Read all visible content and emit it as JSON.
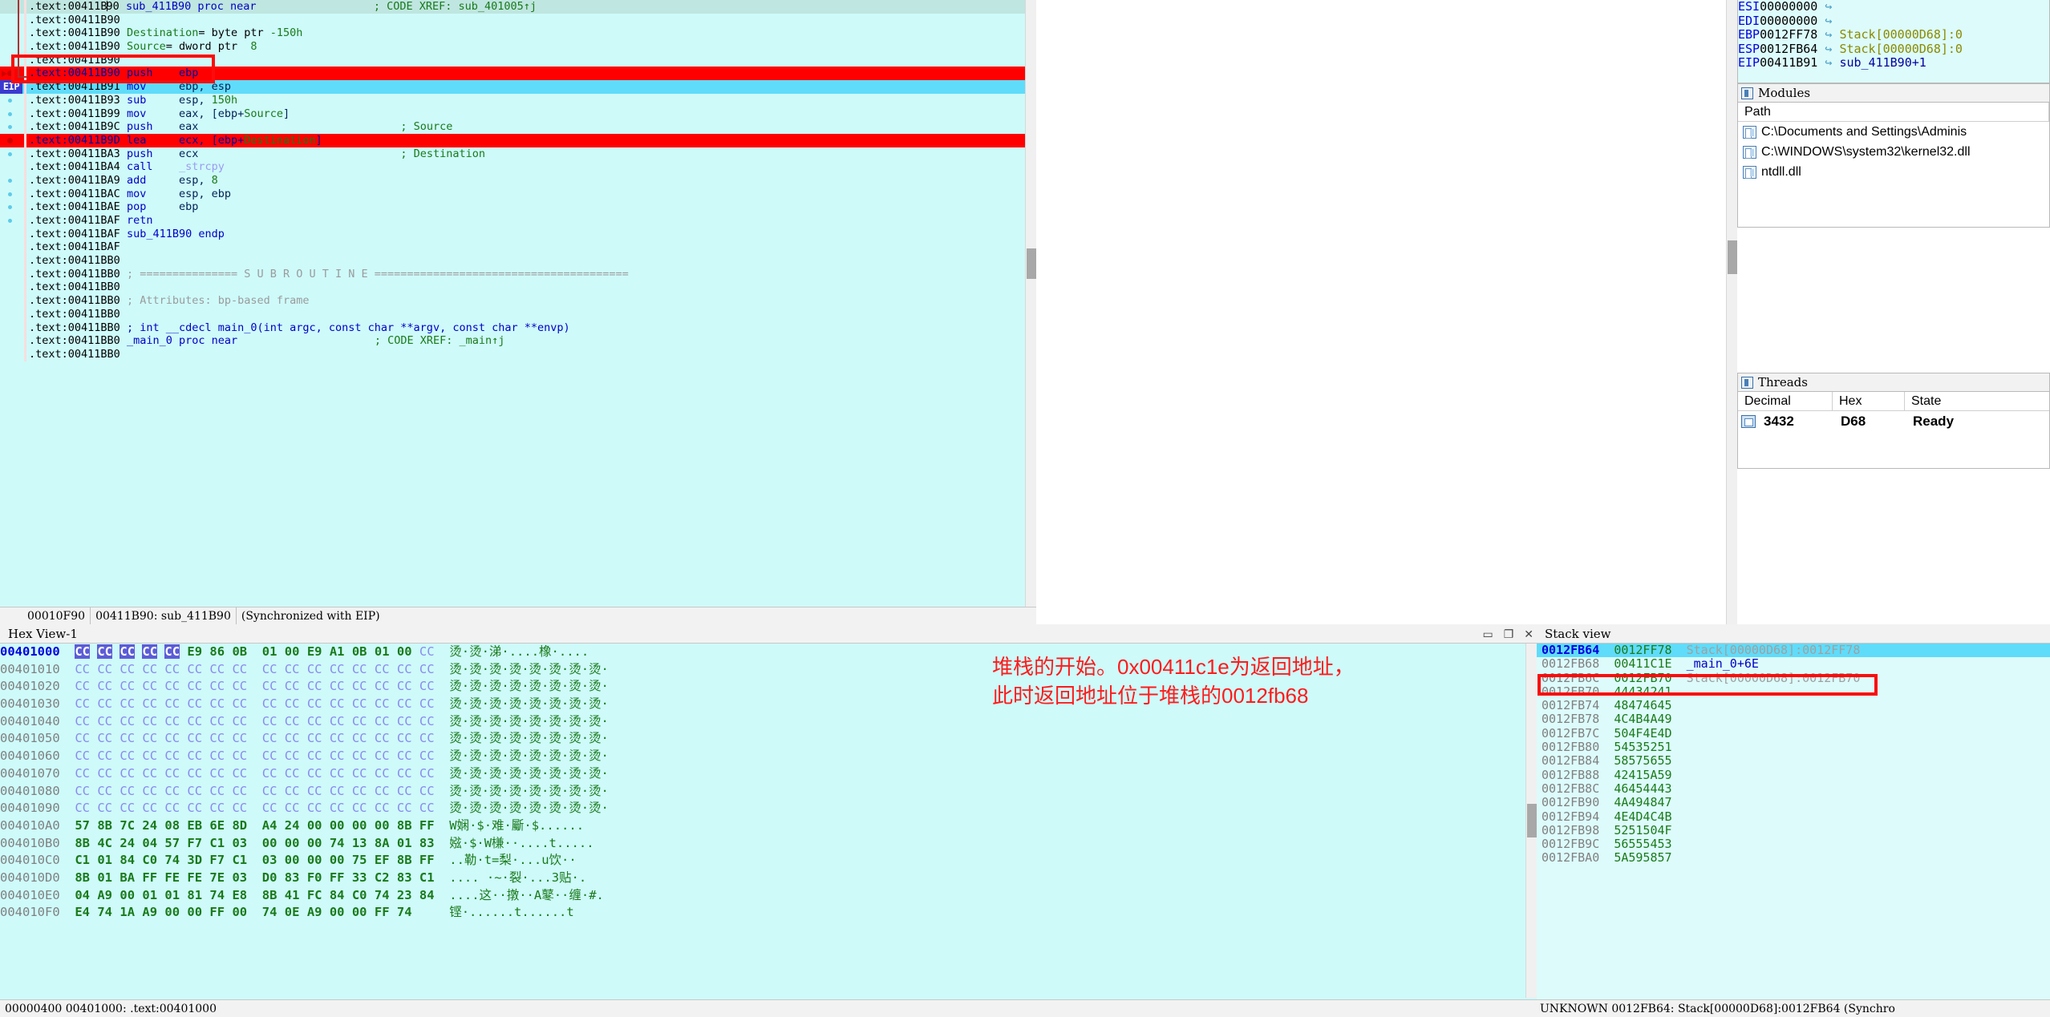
{
  "disassembly": {
    "panel_name": "IDA View",
    "lines": [
      {
        "addr": ".text:00411B90",
        "text": "sub_411B90 proc near",
        "comment": "; CODE XREF: sub_401005↑j",
        "style": "head",
        "kind": "proc"
      },
      {
        "addr": ".text:00411B90",
        "text": "",
        "comment": "",
        "style": "",
        "kind": "blank"
      },
      {
        "addr": ".text:00411B90",
        "text": "Destination= byte ptr -150h",
        "comment": "",
        "style": "",
        "kind": "vardef"
      },
      {
        "addr": ".text:00411B90",
        "text": "Source= dword ptr  8",
        "comment": "",
        "style": "",
        "kind": "vardef"
      },
      {
        "addr": ".text:00411B90",
        "text": "",
        "comment": "",
        "style": "",
        "kind": "blank"
      },
      {
        "addr": ".text:00411B90",
        "mnemonic": "push",
        "operand": "ebp",
        "comment": "",
        "style": "bp-red",
        "kind": "insn"
      },
      {
        "addr": ".text:00411B91",
        "mnemonic": "mov",
        "operand": "ebp, esp",
        "comment": "",
        "style": "eip",
        "kind": "insn"
      },
      {
        "addr": ".text:00411B93",
        "mnemonic": "sub",
        "operand": "esp, 150h",
        "comment": "",
        "style": "",
        "kind": "insn"
      },
      {
        "addr": ".text:00411B99",
        "mnemonic": "mov",
        "operand": "eax, [ebp+Source]",
        "comment": "",
        "style": "",
        "kind": "insn"
      },
      {
        "addr": ".text:00411B9C",
        "mnemonic": "push",
        "operand": "eax",
        "comment": "; Source",
        "style": "",
        "kind": "insn"
      },
      {
        "addr": ".text:00411B9D",
        "mnemonic": "lea",
        "operand": "ecx, [ebp+Destination]",
        "comment": "",
        "style": "bp-red2",
        "kind": "insn"
      },
      {
        "addr": ".text:00411BA3",
        "mnemonic": "push",
        "operand": "ecx",
        "comment": "; Destination",
        "style": "",
        "kind": "insn"
      },
      {
        "addr": ".text:00411BA4",
        "mnemonic": "call",
        "operand": "_strcpy",
        "comment": "",
        "style": "",
        "kind": "call"
      },
      {
        "addr": ".text:00411BA9",
        "mnemonic": "add",
        "operand": "esp, 8",
        "comment": "",
        "style": "",
        "kind": "insn"
      },
      {
        "addr": ".text:00411BAC",
        "mnemonic": "mov",
        "operand": "esp, ebp",
        "comment": "",
        "style": "",
        "kind": "insn"
      },
      {
        "addr": ".text:00411BAE",
        "mnemonic": "pop",
        "operand": "ebp",
        "comment": "",
        "style": "",
        "kind": "insn"
      },
      {
        "addr": ".text:00411BAF",
        "mnemonic": "retn",
        "operand": "",
        "comment": "",
        "style": "",
        "kind": "insn"
      },
      {
        "addr": ".text:00411BAF",
        "text": "sub_411B90 endp",
        "comment": "",
        "style": "",
        "kind": "proc"
      },
      {
        "addr": ".text:00411BAF",
        "text": "",
        "comment": "",
        "style": "",
        "kind": "blank"
      },
      {
        "addr": ".text:00411BB0",
        "text": "",
        "comment": "",
        "style": "",
        "kind": "blank"
      },
      {
        "addr": ".text:00411BB0",
        "text": "; =============== S U B R O U T I N E =======================================",
        "comment": "",
        "style": "",
        "kind": "banner"
      },
      {
        "addr": ".text:00411BB0",
        "text": "",
        "comment": "",
        "style": "",
        "kind": "blank"
      },
      {
        "addr": ".text:00411BB0",
        "text": "; Attributes: bp-based frame",
        "comment": "",
        "style": "",
        "kind": "attrib"
      },
      {
        "addr": ".text:00411BB0",
        "text": "",
        "comment": "",
        "style": "",
        "kind": "blank"
      },
      {
        "addr": ".text:00411BB0",
        "text": "; int __cdecl main_0(int argc, const char **argv, const char **envp)",
        "comment": "",
        "style": "",
        "kind": "proto"
      },
      {
        "addr": ".text:00411BB0",
        "text": "_main_0 proc near",
        "comment": "; CODE XREF: _main↑j",
        "style": "",
        "kind": "proc"
      },
      {
        "addr": ".text:00411BB0",
        "text": "",
        "comment": "",
        "style": "",
        "kind": "blank"
      }
    ],
    "status_bar": [
      "00010F90",
      "00411B90: sub_411B90",
      "(Synchronized with EIP)"
    ],
    "eip_marker": "EIP"
  },
  "registers": {
    "rows": [
      {
        "name": "ESI",
        "value": "00000000",
        "arrow": "↪",
        "ref": "",
        "sym": ""
      },
      {
        "name": "EDI",
        "value": "00000000",
        "arrow": "↪",
        "ref": "",
        "sym": ""
      },
      {
        "name": "EBP",
        "value": "0012FF78",
        "arrow": "↪",
        "ref": "Stack[00000D68]:0",
        "sym": ""
      },
      {
        "name": "ESP",
        "value": "0012FB64",
        "arrow": "↪",
        "ref": "Stack[00000D68]:0",
        "sym": ""
      },
      {
        "name": "EIP",
        "value": "00411B91",
        "arrow": "↪",
        "ref": "",
        "sym": "sub_411B90+1"
      }
    ]
  },
  "modules": {
    "title": "Modules",
    "columns": [
      "Path"
    ],
    "rows": [
      {
        "path": "C:\\Documents and Settings\\Adminis"
      },
      {
        "path": "C:\\WINDOWS\\system32\\kernel32.dll"
      },
      {
        "path": "ntdll.dll"
      }
    ]
  },
  "threads": {
    "title": "Threads",
    "columns": [
      "Decimal",
      "Hex",
      "State"
    ],
    "rows": [
      {
        "decimal": "3432",
        "hex": "D68",
        "state": "Ready"
      }
    ]
  },
  "hexview": {
    "title": "Hex View-1",
    "window_buttons": [
      "▭",
      "❐",
      "✕"
    ],
    "rows": [
      {
        "addr": "00401000",
        "bytes": [
          "CC",
          "CC",
          "CC",
          "CC",
          "CC",
          "E9",
          "86",
          "0B",
          "01",
          "00",
          "E9",
          "A1",
          "0B",
          "01",
          "00",
          "CC"
        ],
        "sel_count": 5,
        "ascii": "烫·烫·涕·....橡·...."
      },
      {
        "addr": "00401010",
        "bytes": [
          "CC",
          "CC",
          "CC",
          "CC",
          "CC",
          "CC",
          "CC",
          "CC",
          "CC",
          "CC",
          "CC",
          "CC",
          "CC",
          "CC",
          "CC",
          "CC"
        ],
        "sel_count": 0,
        "ascii": "烫·烫·烫·烫·烫·烫·烫·烫·"
      },
      {
        "addr": "00401020",
        "bytes": [
          "CC",
          "CC",
          "CC",
          "CC",
          "CC",
          "CC",
          "CC",
          "CC",
          "CC",
          "CC",
          "CC",
          "CC",
          "CC",
          "CC",
          "CC",
          "CC"
        ],
        "sel_count": 0,
        "ascii": "烫·烫·烫·烫·烫·烫·烫·烫·"
      },
      {
        "addr": "00401030",
        "bytes": [
          "CC",
          "CC",
          "CC",
          "CC",
          "CC",
          "CC",
          "CC",
          "CC",
          "CC",
          "CC",
          "CC",
          "CC",
          "CC",
          "CC",
          "CC",
          "CC"
        ],
        "sel_count": 0,
        "ascii": "烫·烫·烫·烫·烫·烫·烫·烫·"
      },
      {
        "addr": "00401040",
        "bytes": [
          "CC",
          "CC",
          "CC",
          "CC",
          "CC",
          "CC",
          "CC",
          "CC",
          "CC",
          "CC",
          "CC",
          "CC",
          "CC",
          "CC",
          "CC",
          "CC"
        ],
        "sel_count": 0,
        "ascii": "烫·烫·烫·烫·烫·烫·烫·烫·"
      },
      {
        "addr": "00401050",
        "bytes": [
          "CC",
          "CC",
          "CC",
          "CC",
          "CC",
          "CC",
          "CC",
          "CC",
          "CC",
          "CC",
          "CC",
          "CC",
          "CC",
          "CC",
          "CC",
          "CC"
        ],
        "sel_count": 0,
        "ascii": "烫·烫·烫·烫·烫·烫·烫·烫·"
      },
      {
        "addr": "00401060",
        "bytes": [
          "CC",
          "CC",
          "CC",
          "CC",
          "CC",
          "CC",
          "CC",
          "CC",
          "CC",
          "CC",
          "CC",
          "CC",
          "CC",
          "CC",
          "CC",
          "CC"
        ],
        "sel_count": 0,
        "ascii": "烫·烫·烫·烫·烫·烫·烫·烫·"
      },
      {
        "addr": "00401070",
        "bytes": [
          "CC",
          "CC",
          "CC",
          "CC",
          "CC",
          "CC",
          "CC",
          "CC",
          "CC",
          "CC",
          "CC",
          "CC",
          "CC",
          "CC",
          "CC",
          "CC"
        ],
        "sel_count": 0,
        "ascii": "烫·烫·烫·烫·烫·烫·烫·烫·"
      },
      {
        "addr": "00401080",
        "bytes": [
          "CC",
          "CC",
          "CC",
          "CC",
          "CC",
          "CC",
          "CC",
          "CC",
          "CC",
          "CC",
          "CC",
          "CC",
          "CC",
          "CC",
          "CC",
          "CC"
        ],
        "sel_count": 0,
        "ascii": "烫·烫·烫·烫·烫·烫·烫·烫·"
      },
      {
        "addr": "00401090",
        "bytes": [
          "CC",
          "CC",
          "CC",
          "CC",
          "CC",
          "CC",
          "CC",
          "CC",
          "CC",
          "CC",
          "CC",
          "CC",
          "CC",
          "CC",
          "CC",
          "CC"
        ],
        "sel_count": 0,
        "ascii": "烫·烫·烫·烫·烫·烫·烫·烫·"
      },
      {
        "addr": "004010A0",
        "bytes": [
          "57",
          "8B",
          "7C",
          "24",
          "08",
          "EB",
          "6E",
          "8D",
          "A4",
          "24",
          "00",
          "00",
          "00",
          "00",
          "8B",
          "FF"
        ],
        "sel_count": 0,
        "ascii": "W娴·$·难·斸·$......"
      },
      {
        "addr": "004010B0",
        "bytes": [
          "8B",
          "4C",
          "24",
          "04",
          "57",
          "F7",
          "C1",
          "03",
          "00",
          "00",
          "00",
          "74",
          "13",
          "8A",
          "01",
          "83"
        ],
        "sel_count": 0,
        "ascii": "娹·$·W槏··....t....."
      },
      {
        "addr": "004010C0",
        "bytes": [
          "C1",
          "01",
          "84",
          "C0",
          "74",
          "3D",
          "F7",
          "C1",
          "03",
          "00",
          "00",
          "00",
          "75",
          "EF",
          "8B",
          "FF"
        ],
        "sel_count": 0,
        "ascii": "..勒·t=梨·...u饮··"
      },
      {
        "addr": "004010D0",
        "bytes": [
          "8B",
          "01",
          "BA",
          "FF",
          "FE",
          "FE",
          "7E",
          "03",
          "D0",
          "83",
          "F0",
          "FF",
          "33",
          "C2",
          "83",
          "C1"
        ],
        "sel_count": 0,
        "ascii": ".... ·~·裂·...3贴·."
      },
      {
        "addr": "004010E0",
        "bytes": [
          "04",
          "A9",
          "00",
          "01",
          "01",
          "81",
          "74",
          "E8",
          "8B",
          "41",
          "FC",
          "84",
          "C0",
          "74",
          "23",
          "84"
        ],
        "sel_count": 0,
        "ascii": "....这··撴··A鼕··缠·#."
      },
      {
        "addr": "004010F0",
        "bytes": [
          "E4",
          "74",
          "1A",
          "A9",
          "00",
          "00",
          "FF",
          "00",
          "74",
          "0E",
          "A9",
          "00",
          "00",
          "FF",
          "74",
          ""
        ],
        "sel_count": 0,
        "ascii": "铿·......t......t"
      }
    ],
    "status_bar": [
      "00000400 00401000: .text:00401000"
    ]
  },
  "stackview": {
    "title": "Stack view",
    "rows": [
      {
        "addr": "0012FB64",
        "value": "0012FF78",
        "ref": "Stack[00000D68]:0012FF78",
        "sym": "",
        "selected": true
      },
      {
        "addr": "0012FB68",
        "value": "00411C1E",
        "ref": "",
        "sym": "_main_0+6E",
        "selected": false,
        "annotated": true
      },
      {
        "addr": "0012FB6C",
        "value": "0012FB70",
        "ref": "Stack[00000D68]:0012FB70",
        "sym": "",
        "selected": false
      },
      {
        "addr": "0012FB70",
        "value": "44434241",
        "ref": "",
        "sym": "",
        "selected": false
      },
      {
        "addr": "0012FB74",
        "value": "48474645",
        "ref": "",
        "sym": "",
        "selected": false
      },
      {
        "addr": "0012FB78",
        "value": "4C4B4A49",
        "ref": "",
        "sym": "",
        "selected": false
      },
      {
        "addr": "0012FB7C",
        "value": "504F4E4D",
        "ref": "",
        "sym": "",
        "selected": false
      },
      {
        "addr": "0012FB80",
        "value": "54535251",
        "ref": "",
        "sym": "",
        "selected": false
      },
      {
        "addr": "0012FB84",
        "value": "58575655",
        "ref": "",
        "sym": "",
        "selected": false
      },
      {
        "addr": "0012FB88",
        "value": "42415A59",
        "ref": "",
        "sym": "",
        "selected": false
      },
      {
        "addr": "0012FB8C",
        "value": "46454443",
        "ref": "",
        "sym": "",
        "selected": false
      },
      {
        "addr": "0012FB90",
        "value": "4A494847",
        "ref": "",
        "sym": "",
        "selected": false
      },
      {
        "addr": "0012FB94",
        "value": "4E4D4C4B",
        "ref": "",
        "sym": "",
        "selected": false
      },
      {
        "addr": "0012FB98",
        "value": "5251504F",
        "ref": "",
        "sym": "",
        "selected": false
      },
      {
        "addr": "0012FB9C",
        "value": "56555453",
        "ref": "",
        "sym": "",
        "selected": false
      },
      {
        "addr": "0012FBA0",
        "value": "5A595857",
        "ref": "",
        "sym": "",
        "selected": false
      }
    ],
    "status_bar": "UNKNOWN 0012FB64: Stack[00000D68]:0012FB64 (Synchro"
  },
  "annotation": {
    "note_text": "堆栈的开始。0x00411c1e为返回地址，\n此时返回地址位于堆栈的0012fb68",
    "color": "#ff1b1b"
  },
  "colors": {
    "disasm_bg": "#cefafa",
    "highlight_red": "#ff0000",
    "eip_blue": "#5fdcfa",
    "annotation_red": "#fb0c0c",
    "hex_selected": "#5c5cd6"
  }
}
